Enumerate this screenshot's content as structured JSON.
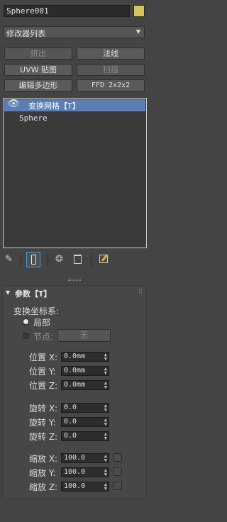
{
  "object": {
    "name": "Sphere001",
    "color": "#d6c35a"
  },
  "modifier_list": {
    "label": "修改器列表"
  },
  "buttons": {
    "extrude": "挤出",
    "normal": "法线",
    "uvw_map": "UVW 贴图",
    "sweep": "扫描",
    "edit_poly": "编辑多边形",
    "ffd": "FFD 2x2x2"
  },
  "stack": {
    "items": [
      {
        "label": "变换网格【T】",
        "selected": true,
        "eye_icon": "eye-icon"
      },
      {
        "label": "Sphere",
        "selected": false
      }
    ]
  },
  "rollout": {
    "title": "参数【T】",
    "transform_space_label": "变换坐标系:",
    "local_label": "局部",
    "node_label": "节点:",
    "node_value": "无",
    "position": [
      {
        "label": "位置 X:",
        "value": "0.0mm"
      },
      {
        "label": "位置 Y:",
        "value": "0.0mm"
      },
      {
        "label": "位置 Z:",
        "value": "0.0mm"
      }
    ],
    "rotation": [
      {
        "label": "旋转 X:",
        "value": "0.0"
      },
      {
        "label": "旋转 Y:",
        "value": "0.0"
      },
      {
        "label": "旋转 Z:",
        "value": "0.0"
      }
    ],
    "scale": [
      {
        "label": "缩放 X:",
        "value": "100.0"
      },
      {
        "label": "缩放 Y:",
        "value": "100.0"
      },
      {
        "label": "缩放 Z:",
        "value": "100.0"
      }
    ]
  },
  "colors": {
    "panel": "#444444",
    "selection": "#5b7fb4",
    "accent": "#4aa0d8"
  }
}
